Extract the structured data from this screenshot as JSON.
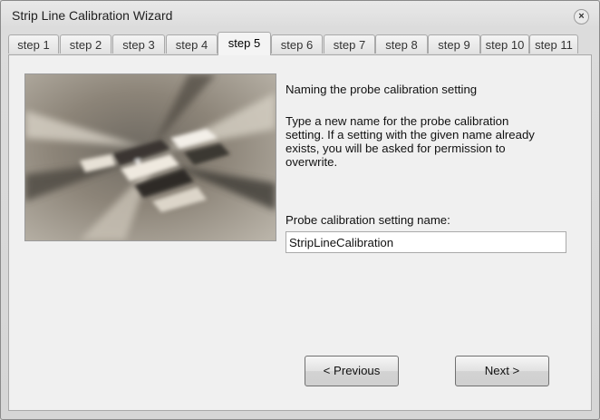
{
  "window": {
    "title": "Strip Line Calibration Wizard",
    "close_glyph": "×"
  },
  "tabs": [
    {
      "label": "step 1"
    },
    {
      "label": "step 2"
    },
    {
      "label": "step 3"
    },
    {
      "label": "step 4"
    },
    {
      "label": "step 5",
      "active": true
    },
    {
      "label": "step 6"
    },
    {
      "label": "step 7"
    },
    {
      "label": "step 8"
    },
    {
      "label": "step 9"
    },
    {
      "label": "step 10"
    },
    {
      "label": "step 11"
    }
  ],
  "content": {
    "heading": "Naming the probe calibration setting",
    "description_lines": [
      "Type a new name for the probe calibration",
      "setting. If a setting with the given name already",
      "exists, you will be asked for permission to",
      "overwrite."
    ],
    "field_label": "Probe calibration setting name:",
    "field_value": "StripLineCalibration"
  },
  "buttons": {
    "previous": "< Previous",
    "next": "Next >"
  },
  "colors": {
    "window_bg": "#d6d6d6",
    "panel_bg": "#f0f0f0",
    "border": "#a9a9a9"
  }
}
